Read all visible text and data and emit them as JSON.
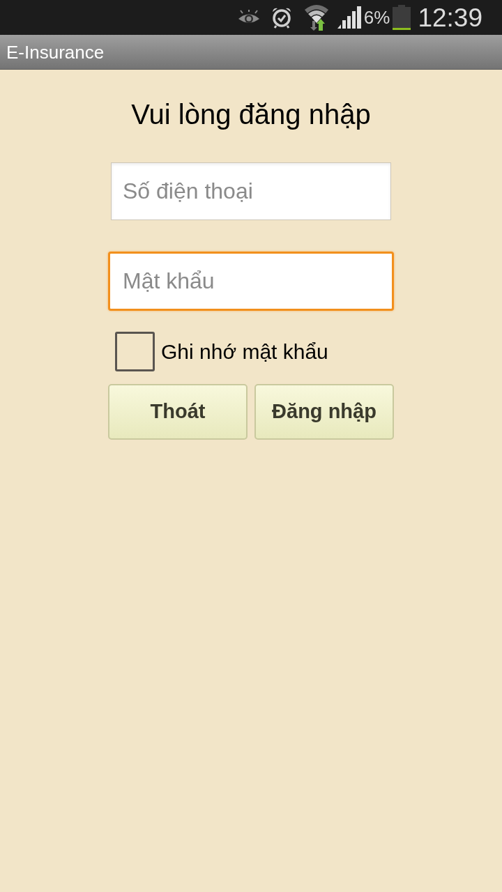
{
  "status_bar": {
    "battery_text": "6%",
    "time": "12:39"
  },
  "title_bar": {
    "title": "E-Insurance"
  },
  "login": {
    "heading": "Vui lòng đăng nhập",
    "fields": [
      {
        "placeholder": "Số điện thoại",
        "focused": false
      },
      {
        "placeholder": "Mật khẩu",
        "focused": true
      }
    ],
    "remember": {
      "label": "Ghi nhớ mật khẩu",
      "checked": false
    },
    "buttons": [
      {
        "label": "Thoát"
      },
      {
        "label": "Đăng nhập"
      }
    ]
  }
}
